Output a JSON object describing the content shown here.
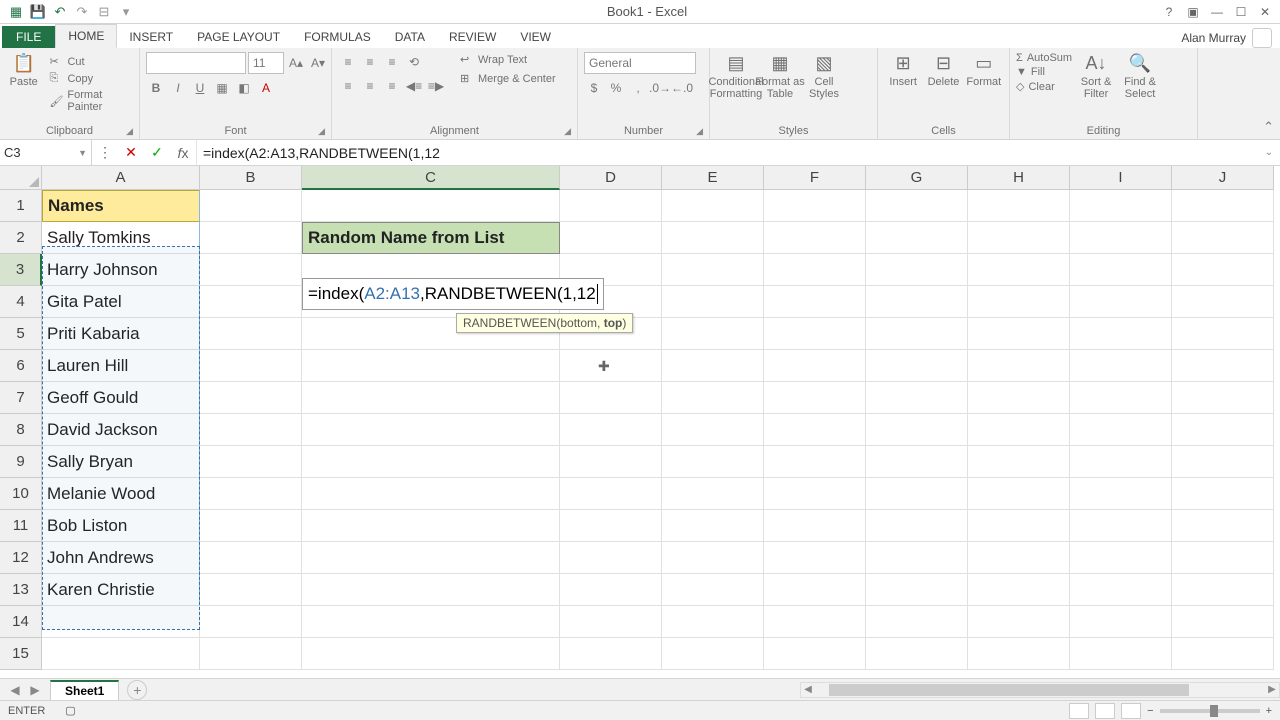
{
  "title": "Book1 - Excel",
  "user_name": "Alan Murray",
  "tabs": {
    "file": "FILE",
    "items": [
      "HOME",
      "INSERT",
      "PAGE LAYOUT",
      "FORMULAS",
      "DATA",
      "REVIEW",
      "VIEW"
    ],
    "active": "HOME"
  },
  "ribbon": {
    "clipboard": {
      "label": "Clipboard",
      "paste": "Paste",
      "cut": "Cut",
      "copy": "Copy",
      "format_painter": "Format Painter"
    },
    "font": {
      "label": "Font",
      "size": "11"
    },
    "alignment": {
      "label": "Alignment",
      "wrap": "Wrap Text",
      "merge": "Merge & Center"
    },
    "number": {
      "label": "Number",
      "format": "General"
    },
    "styles": {
      "label": "Styles",
      "cond": "Conditional\nFormatting",
      "table": "Format as\nTable",
      "cell": "Cell\nStyles"
    },
    "cells": {
      "label": "Cells",
      "insert": "Insert",
      "delete": "Delete",
      "format": "Format"
    },
    "editing": {
      "label": "Editing",
      "autosum": "AutoSum",
      "fill": "Fill",
      "clear": "Clear",
      "sort": "Sort &\nFilter",
      "find": "Find &\nSelect"
    }
  },
  "name_box": "C3",
  "formula_bar": "=index(A2:A13,RANDBETWEEN(1,12",
  "columns": [
    "A",
    "B",
    "C",
    "D",
    "E",
    "F",
    "G",
    "H",
    "I",
    "J"
  ],
  "active_col": "C",
  "active_row": 3,
  "row_count": 15,
  "cells": {
    "A1": "Names",
    "A2": "Sally Tomkins",
    "A3": "Harry Johnson",
    "A4": "Gita Patel",
    "A5": "Priti Kabaria",
    "A6": "Lauren Hill",
    "A7": "Geoff Gould",
    "A8": "David Jackson",
    "A9": "Sally Bryan",
    "A10": "Melanie Wood",
    "A11": "Bob Liston",
    "A12": "John Andrews",
    "A13": "Karen Christie",
    "C2": "Random Name from List"
  },
  "editing": {
    "prefix": "=index(",
    "ref": "A2:A13",
    "suffix": ",RANDBETWEEN(1,12"
  },
  "tooltip": {
    "fn": "RANDBETWEEN(",
    "arg1": "bottom",
    "sep": ", ",
    "arg2": "top",
    "close": ")"
  },
  "sheet_tab": "Sheet1",
  "status": "ENTER"
}
